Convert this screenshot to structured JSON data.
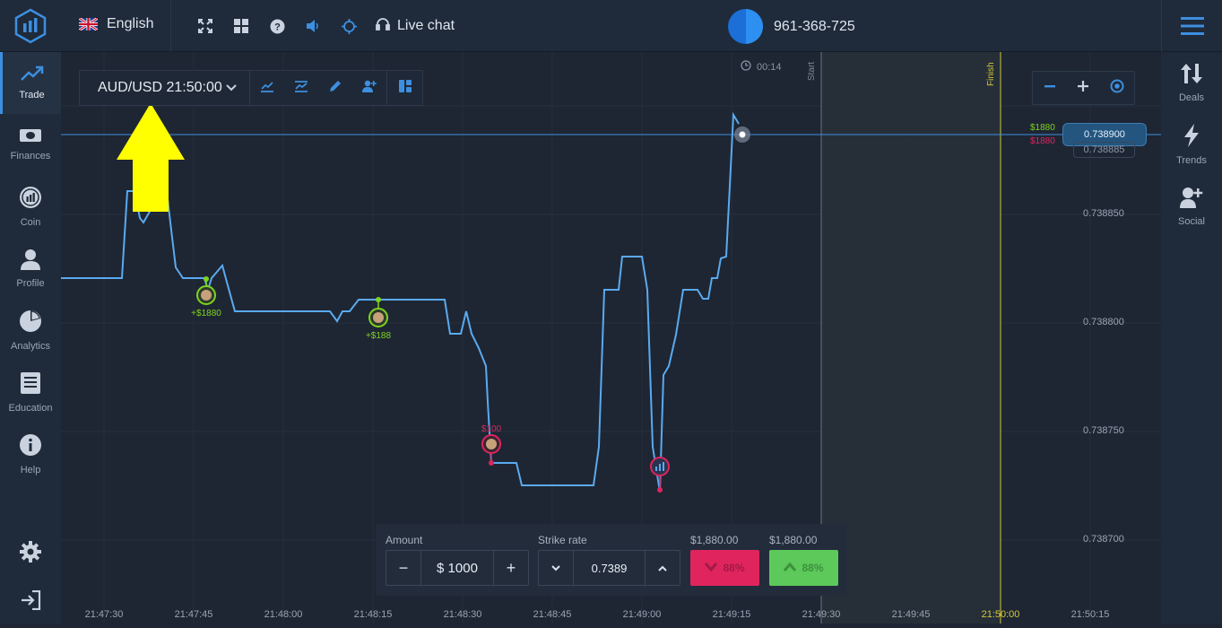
{
  "topbar": {
    "language": "English",
    "live_chat": "Live chat",
    "account_number": "961-368-725",
    "icons": [
      "logo-icon",
      "uk-flag-icon",
      "fullscreen-icon",
      "grid-icon",
      "help-icon",
      "sound-icon",
      "crosshair-icon",
      "headset-icon",
      "menu-icon"
    ]
  },
  "sidebar": {
    "items": [
      {
        "label": "Trade",
        "icon": "trend-up-icon"
      },
      {
        "label": "Finances",
        "icon": "cash-icon"
      },
      {
        "label": "Coin",
        "icon": "coin-icon"
      },
      {
        "label": "Profile",
        "icon": "user-icon"
      },
      {
        "label": "Analytics",
        "icon": "pie-chart-icon"
      },
      {
        "label": "Education",
        "icon": "book-icon"
      },
      {
        "label": "Help",
        "icon": "info-icon"
      }
    ]
  },
  "rightbar": {
    "items": [
      {
        "label": "Deals",
        "icon": "arrows-updown-icon"
      },
      {
        "label": "Trends",
        "icon": "lightning-icon"
      },
      {
        "label": "Social",
        "icon": "add-user-icon"
      }
    ]
  },
  "chart_toolbar": {
    "asset": "AUD/USD 21:50:00"
  },
  "chart": {
    "timer": "00:14",
    "start_label": "Start",
    "finish_label": "Finish",
    "current_price": "0.738900",
    "strike_price": "0.738885",
    "up_payout": "$1880",
    "down_payout": "$1880",
    "y_ticks": [
      "0.738900",
      "0.738850",
      "0.738800",
      "0.738750",
      "0.738700"
    ],
    "x_ticks": [
      "21:47:30",
      "21:47:45",
      "21:48:00",
      "21:48:15",
      "21:48:30",
      "21:48:45",
      "21:49:00",
      "21:49:15",
      "21:49:30",
      "21:49:45",
      "21:50:00",
      "21:50:15"
    ],
    "markers": [
      {
        "label": "+$1880",
        "color": "#7ed321"
      },
      {
        "label": "+$188",
        "color": "#7ed321"
      },
      {
        "label": "$100",
        "color": "#e0245e"
      }
    ],
    "colors": {
      "line": "#5aaaf0",
      "finish": "#d4c73a",
      "up": "#5cc95a",
      "down": "#e0245e",
      "arrow": "#ffff00"
    }
  },
  "chart_data": {
    "type": "line",
    "x": [
      "21:47:30",
      "21:47:45",
      "21:47:52",
      "21:47:53",
      "21:47:55",
      "21:48:00",
      "21:48:10",
      "21:48:12",
      "21:48:15",
      "21:48:30",
      "21:48:32",
      "21:48:35",
      "21:48:38",
      "21:48:45",
      "21:48:52",
      "21:48:55",
      "21:48:58",
      "21:49:00",
      "21:49:01",
      "21:49:02",
      "21:49:05",
      "21:49:08",
      "21:49:10",
      "21:49:12",
      "21:49:14",
      "21:49:16"
    ],
    "values": [
      0.738805,
      0.73882,
      0.7388,
      0.738812,
      0.7388,
      0.7388,
      0.738795,
      0.7388,
      0.738805,
      0.738805,
      0.738792,
      0.738775,
      0.738735,
      0.738725,
      0.738725,
      0.73881,
      0.738825,
      0.738825,
      0.73881,
      0.738725,
      0.738775,
      0.73881,
      0.73881,
      0.73882,
      0.73883,
      0.73891
    ],
    "ylim": [
      0.73866,
      0.73893
    ]
  },
  "trade_panel": {
    "amount_label": "Amount",
    "amount_value": "$ 1000",
    "strike_label": "Strike rate",
    "strike_value": "0.7389",
    "down_payout": "$1,880.00",
    "up_payout": "$1,880.00",
    "down_percent": "88%",
    "up_percent": "88%"
  }
}
